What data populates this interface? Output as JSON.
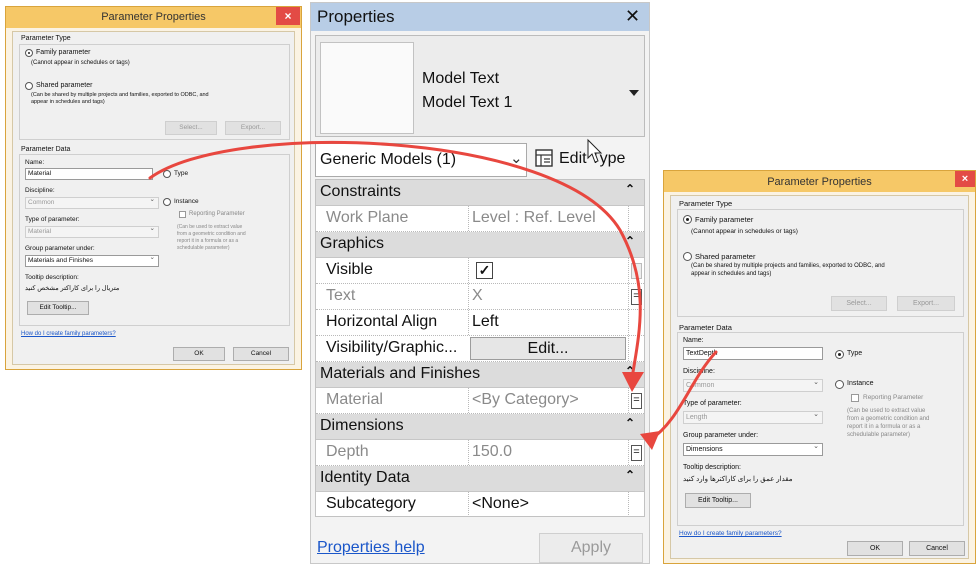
{
  "left_dialog": {
    "title": "Parameter Properties",
    "close": "×",
    "parameter_type_label": "Parameter Type",
    "family_parameter": "Family parameter",
    "family_note": "(Cannot appear in schedules or tags)",
    "shared_parameter": "Shared parameter",
    "shared_note_1": "(Can be shared by multiple projects and families, exported to ODBC, and",
    "shared_note_2": "appear in schedules and tags)",
    "select_btn": "Select...",
    "export_btn": "Export...",
    "parameter_data_label": "Parameter Data",
    "name_label": "Name:",
    "name_value": "Material",
    "type_radio": "Type",
    "instance_radio": "Instance",
    "discipline_label": "Discipline:",
    "discipline_value": "Common",
    "type_of_parameter_label": "Type of parameter:",
    "type_of_parameter_value": "Material",
    "reporting_parameter": "Reporting Parameter",
    "reporting_note_1": "(Can be used to extract value",
    "reporting_note_2": "from a geometric condition and",
    "reporting_note_3": "report it in a formula or as a",
    "reporting_note_4": "schedulable parameter)",
    "group_label": "Group parameter under:",
    "group_value": "Materials and Finishes",
    "tooltip_label": "Tooltip description:",
    "tooltip_value": "متریال را برای کاراکتر مشخص کنید",
    "edit_tooltip_btn": "Edit Tooltip...",
    "help_link": "How do I create family parameters?",
    "ok_btn": "OK",
    "cancel_btn": "Cancel"
  },
  "properties": {
    "title": "Properties",
    "close": "✕",
    "type_line1": "Model Text",
    "type_line2": "Model Text 1",
    "type_dropdown_icon": "triangle-down-icon",
    "selector": "Generic Models (1)",
    "edit_type": "Edit Type",
    "sections": {
      "constraints": "Constraints",
      "graphics": "Graphics",
      "materials": "Materials and Finishes",
      "dimensions": "Dimensions",
      "identity": "Identity Data"
    },
    "rows": {
      "work_plane": {
        "key": "Work Plane",
        "value": "Level : Ref. Level"
      },
      "visible": {
        "key": "Visible",
        "checked": true,
        "check": "✓"
      },
      "text": {
        "key": "Text",
        "value": "X"
      },
      "horizontal_align": {
        "key": "Horizontal Align",
        "value": "Left"
      },
      "visibility_graphics": {
        "key": "Visibility/Graphic...",
        "button": "Edit..."
      },
      "material": {
        "key": "Material",
        "value": "<By Category>"
      },
      "depth": {
        "key": "Depth",
        "value": "150.0"
      },
      "subcategory": {
        "key": "Subcategory",
        "value": "<None>"
      }
    },
    "assoc_symbol": "=",
    "collapse_symbol": "⌃",
    "help_link": "Properties help",
    "apply_btn": "Apply"
  },
  "right_dialog": {
    "title": "Parameter Properties",
    "close": "×",
    "parameter_type_label": "Parameter Type",
    "family_parameter": "Family parameter",
    "family_note": "(Cannot appear in schedules or tags)",
    "shared_parameter": "Shared parameter",
    "shared_note_1": "(Can be shared by multiple projects and families, exported to ODBC, and",
    "shared_note_2": "appear in schedules and tags)",
    "select_btn": "Select...",
    "export_btn": "Export...",
    "parameter_data_label": "Parameter Data",
    "name_label": "Name:",
    "name_value": "TextDepth",
    "type_radio": "Type",
    "instance_radio": "Instance",
    "discipline_label": "Discipline:",
    "discipline_value": "Common",
    "type_of_parameter_label": "Type of parameter:",
    "type_of_parameter_value": "Length",
    "reporting_parameter": "Reporting Parameter",
    "reporting_note_1": "(Can be used to extract value",
    "reporting_note_2": "from a geometric condition and",
    "reporting_note_3": "report it in a formula or as a",
    "reporting_note_4": "schedulable parameter)",
    "group_label": "Group parameter under:",
    "group_value": "Dimensions",
    "tooltip_label": "Tooltip description:",
    "tooltip_value": "مقدار عمق را برای کاراکترها وارد کنید",
    "edit_tooltip_btn": "Edit Tooltip...",
    "help_link": "How do I create family parameters?",
    "ok_btn": "OK",
    "cancel_btn": "Cancel"
  },
  "colors": {
    "arrow": "#e8473f",
    "dialog_title_bar": "#f6c867",
    "properties_title_bar": "#b8cde6"
  }
}
